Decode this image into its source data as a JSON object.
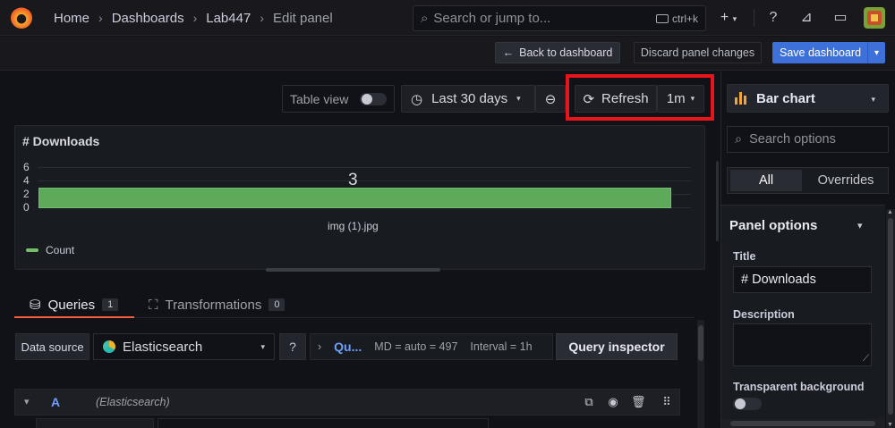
{
  "breadcrumb": {
    "items": [
      "Home",
      "Dashboards",
      "Lab447",
      "Edit panel"
    ]
  },
  "search": {
    "placeholder": "Search or jump to...",
    "shortcut": "ctrl+k"
  },
  "topbar_icons": [
    "plus-icon",
    "help-icon",
    "news-icon",
    "kiosk-icon",
    "avatar"
  ],
  "actions": {
    "back": "Back to dashboard",
    "discard": "Discard panel changes",
    "save": "Save dashboard"
  },
  "toolbar": {
    "table_view": "Table view",
    "time_range": "Last 30 days",
    "refresh": "Refresh",
    "interval": "1m"
  },
  "panel": {
    "title": "# Downloads",
    "y_ticks": [
      "6",
      "4",
      "2",
      "0"
    ],
    "bar_value_label": "3",
    "category_label": "img (1).jpg",
    "legend": "Count"
  },
  "chart_data": {
    "type": "bar",
    "orientation": "horizontal",
    "categories": [
      "img (1).jpg"
    ],
    "series": [
      {
        "name": "Count",
        "values": [
          3
        ]
      }
    ],
    "ylim": [
      0,
      6
    ],
    "legend_position": "bottom-left",
    "colors": [
      "#73bf69"
    ]
  },
  "tabs": [
    {
      "label": "Queries",
      "count": "1"
    },
    {
      "label": "Transformations",
      "count": "0"
    }
  ],
  "query": {
    "datasource_label": "Data source",
    "datasource": "Elasticsearch",
    "options_short": "Qu...",
    "md": "MD = auto = 497",
    "interval": "Interval = 1h",
    "inspector": "Query inspector",
    "ref_id": "A",
    "ref_datasource": "(Elasticsearch)"
  },
  "right": {
    "viz": "Bar chart",
    "search_placeholder": "Search options",
    "seg_all": "All",
    "seg_overrides": "Overrides",
    "section": "Panel options",
    "title_label": "Title",
    "title_value": "# Downloads",
    "description_label": "Description",
    "transparent_label": "Transparent background"
  },
  "colors": {
    "accent_red": "#e8141b",
    "primary": "#3d71d9",
    "bar": "#73bf69",
    "tab_active": "#f55f3e"
  }
}
